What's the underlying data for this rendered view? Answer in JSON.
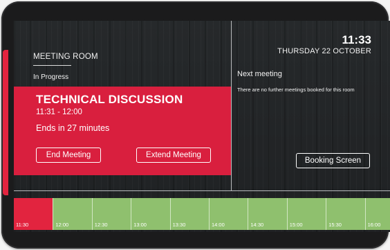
{
  "room": {
    "label": "MEETING ROOM",
    "status": "In Progress"
  },
  "current_meeting": {
    "title": "TECHNICAL DISCUSSION",
    "time": "11:31 - 12:00",
    "ends_text": "Ends in 27 minutes",
    "end_button": "End Meeting",
    "extend_button": "Extend Meeting"
  },
  "header": {
    "time": "11:33",
    "date": "THURSDAY 22 OCTOBER"
  },
  "next_meeting": {
    "title": "Next meeting",
    "message": "There are no further meetings booked for this room"
  },
  "booking_button": "Booking Screen",
  "timeline": {
    "slots": [
      "11:30",
      "12:00",
      "12:30",
      "13:00",
      "13:30",
      "14:00",
      "14:30",
      "15:00",
      "15:30",
      "16:00"
    ],
    "current_slot": "11:30"
  },
  "colors": {
    "accent_red": "#d91f3e",
    "free_green": "#8fc06e",
    "background": "#222426"
  }
}
